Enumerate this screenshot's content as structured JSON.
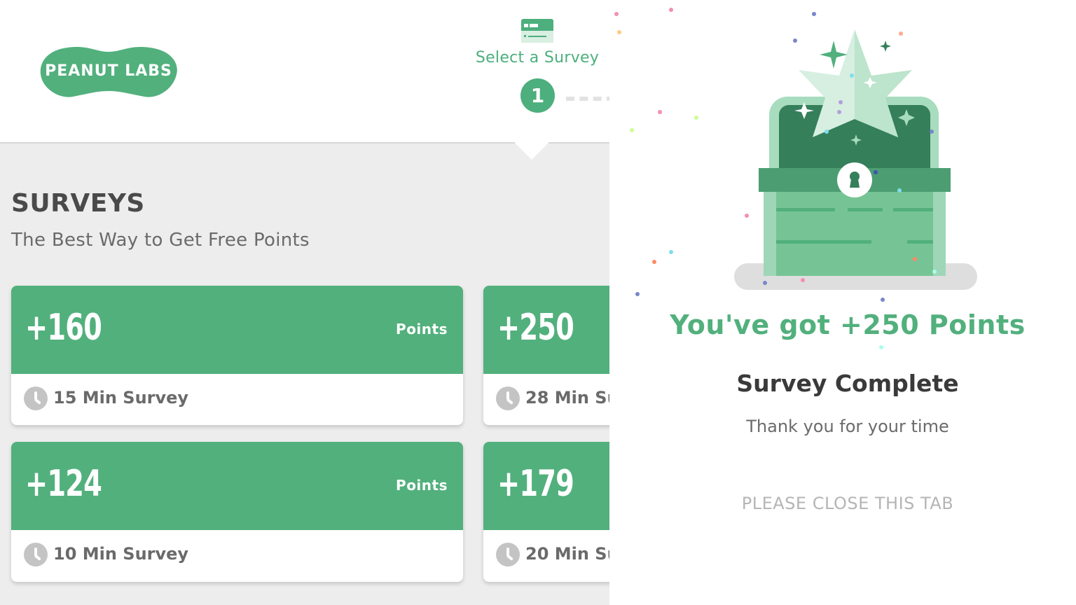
{
  "brand": {
    "logo_text": "PEANUT LABS",
    "color": "#52b07d"
  },
  "stepper": {
    "label": "Select a Survey",
    "step_number": "1"
  },
  "surveys_page": {
    "title": "SURVEYS",
    "subtitle": "The Best Way to Get Free Points",
    "points_label": "Points",
    "cards": [
      {
        "points": "+160",
        "duration": "15 Min Survey"
      },
      {
        "points": "+250",
        "duration": "28 Min Su"
      },
      {
        "points": "+124",
        "duration": "10 Min Survey"
      },
      {
        "points": "+179",
        "duration": "20 Min Su"
      }
    ]
  },
  "reward": {
    "headline": "You've got +250 Points",
    "status": "Survey Complete",
    "message": "Thank you for your time",
    "instruction": "PLEASE CLOSE THIS TAB",
    "icon": "treasure-chest-with-star-icon"
  }
}
